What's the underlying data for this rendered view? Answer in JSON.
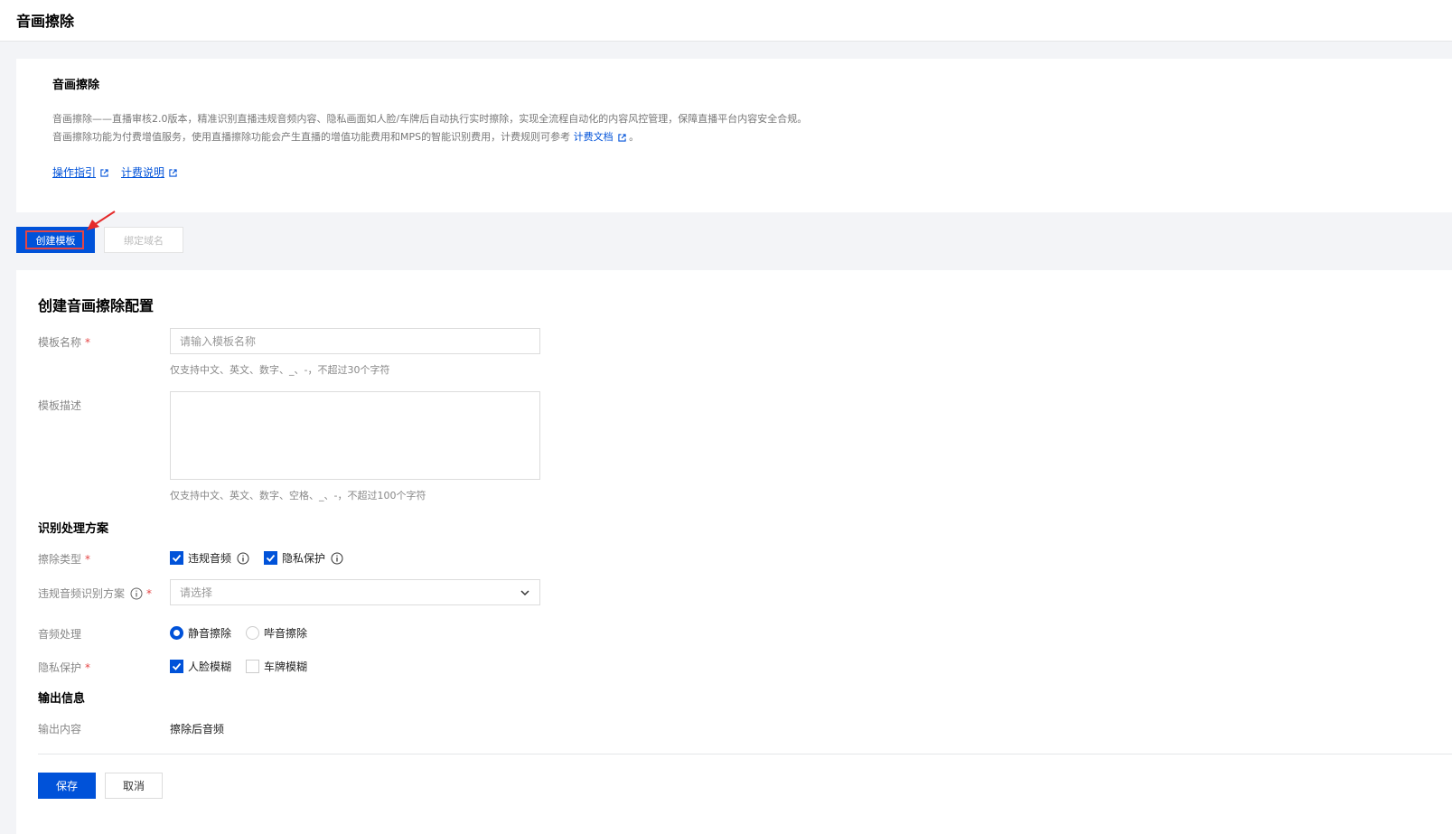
{
  "page": {
    "title": "音画擦除"
  },
  "intro": {
    "heading": "音画擦除",
    "line1": "音画擦除——直播审核2.0版本，精准识别直播违规音频内容、隐私画面如人脸/车牌后自动执行实时擦除，实现全流程自动化的内容风控管理，保障直播平台内容安全合规。",
    "line2_prefix": "音画擦除功能为付费增值服务，使用直播擦除功能会产生直播的增值功能费用和MPS的智能识别费用，计费规则可参考",
    "line2_link": "计费文档",
    "line2_suffix": "。",
    "links": [
      "操作指引",
      "计费说明"
    ]
  },
  "toolbar": {
    "create_label": "创建模板",
    "bind_label": "绑定域名"
  },
  "form": {
    "title": "创建音画擦除配置",
    "name": {
      "label": "模板名称",
      "placeholder": "请输入模板名称",
      "hint": "仅支持中文、英文、数字、_、-，不超过30个字符"
    },
    "desc": {
      "label": "模板描述",
      "hint": "仅支持中文、英文、数字、空格、_、-，不超过100个字符"
    },
    "section_recognition": "识别处理方案",
    "erase_type": {
      "label": "擦除类型",
      "options": [
        "违规音频",
        "隐私保护"
      ]
    },
    "audio_scheme": {
      "label": "违规音频识别方案",
      "placeholder": "请选择"
    },
    "audio_process": {
      "label": "音频处理",
      "options": [
        "静音擦除",
        "哔音擦除"
      ]
    },
    "privacy": {
      "label": "隐私保护",
      "options": [
        "人脸模糊",
        "车牌模糊"
      ]
    },
    "section_output": "输出信息",
    "output": {
      "label": "输出内容",
      "value": "擦除后音频"
    },
    "save_label": "保存",
    "cancel_label": "取消"
  },
  "colors": {
    "primary": "#0052d9",
    "required": "#e54545",
    "highlight": "#e54545"
  }
}
